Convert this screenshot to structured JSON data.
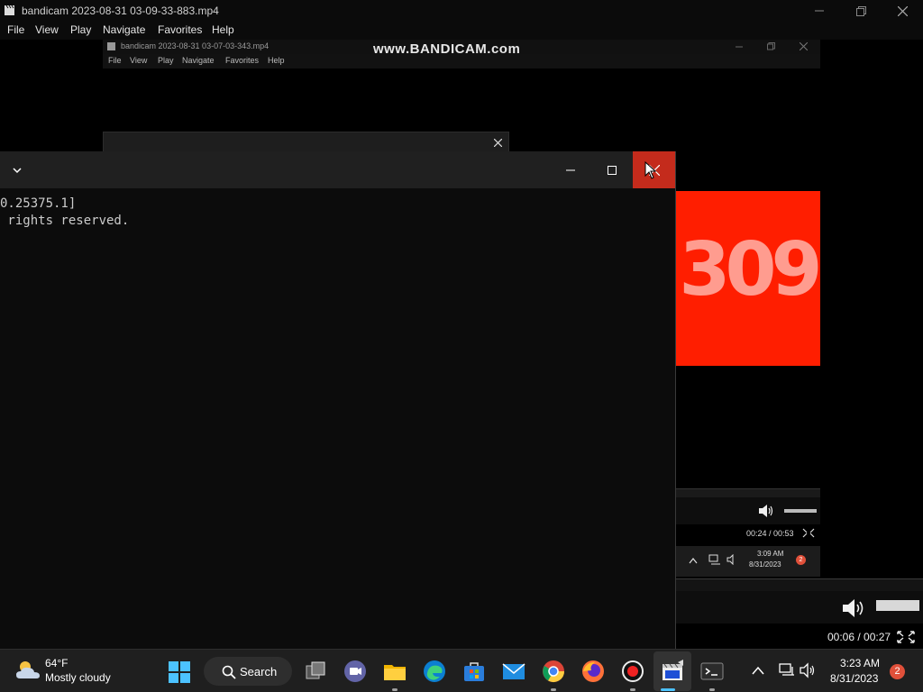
{
  "outer_player": {
    "title": "bandicam 2023-08-31 03-09-33-883.mp4",
    "menu": [
      "File",
      "View",
      "Play",
      "Navigate",
      "Favorites",
      "Help"
    ],
    "time": "00:06 / 00:27"
  },
  "inner_player": {
    "title": "bandicam 2023-08-31 03-07-03-343.mp4",
    "menu": [
      "File",
      "View",
      "Play",
      "Navigate",
      "Favorites",
      "Help"
    ],
    "time": "00:24 / 00:53",
    "clock_time": "3:09 AM",
    "clock_date": "8/31/2023",
    "badge": "2",
    "video_text": "309"
  },
  "watermark": "www.BANDICAM.com",
  "terminal": {
    "lines": [
      "0.25375.1]",
      " rights reserved."
    ]
  },
  "taskbar": {
    "weather_temp": "64°F",
    "weather_desc": "Mostly cloudy",
    "search_label": "Search",
    "clock_time": "3:23 AM",
    "clock_date": "8/31/2023",
    "notification_count": "2"
  },
  "colors": {
    "close_red": "#c42b1c",
    "video_red": "#ff1e00",
    "taskbar_bg": "#1f1f1f"
  }
}
